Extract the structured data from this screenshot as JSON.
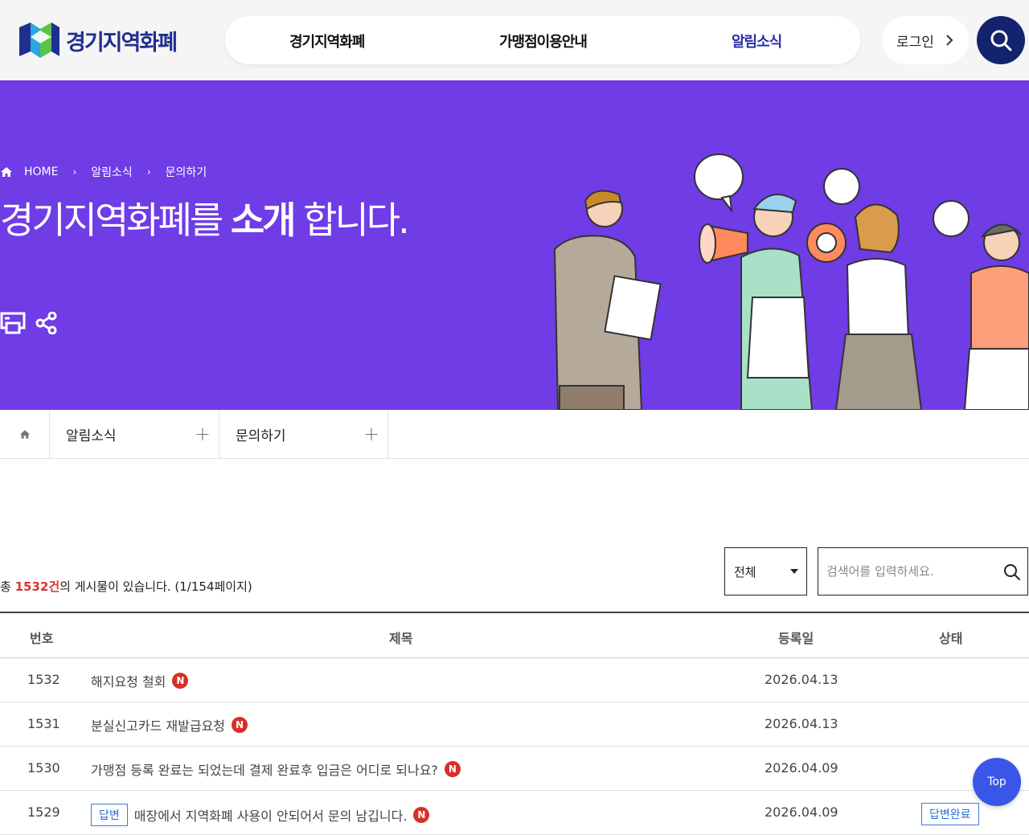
{
  "header": {
    "logo_text": "경기지역화폐",
    "nav": [
      {
        "label": "경기지역화폐"
      },
      {
        "label": "가맹점이용안내"
      },
      {
        "label": "알림소식"
      }
    ],
    "login_label": "로그인",
    "search_icon": "search-icon"
  },
  "hero": {
    "breadcrumb": {
      "home": "HOME",
      "level1": "알림소식",
      "level2": "문의하기"
    },
    "title_pre": "경기지역화폐를 ",
    "title_bold": "소개",
    "title_post": " 합니다.",
    "tools": [
      "print-icon",
      "share-icon"
    ],
    "background": "#6f3ce6"
  },
  "subnav": {
    "cell1": "알림소식",
    "cell2": "문의하기"
  },
  "board": {
    "total_pre": "총 ",
    "total_count": "1532건",
    "total_post": "의 게시물이 있습니다. (1/154페이지)",
    "select_value": "전체",
    "search_placeholder": "검색어를 입력하세요.",
    "columns": {
      "no": "번호",
      "title": "제목",
      "date": "등록일",
      "status": "상태"
    },
    "rows": [
      {
        "no": "1532",
        "title": "해지요청 철회",
        "new": "N",
        "date": "2026.04.13"
      },
      {
        "no": "1531",
        "title": "분실신고카드 재발급요청",
        "new": "N",
        "date": "2026.04.13"
      },
      {
        "no": "1530",
        "title": "가맹점 등록 완료는 되었는데 결제 완료후 입금은 어디로 되나요?",
        "new": "N",
        "date": "2026.04.09"
      },
      {
        "no": "1529",
        "tag": "답변",
        "title": "매장에서 지역화폐 사용이 안되어서 문의 남깁니다.",
        "new": "N",
        "date": "2026.04.09",
        "status": "답변완료"
      }
    ]
  },
  "top_button": "Top",
  "colors": {
    "brand": "#13236e",
    "accent": "#6f3ce6",
    "new_badge": "#d63028",
    "link_blue": "#2f6fcf"
  }
}
